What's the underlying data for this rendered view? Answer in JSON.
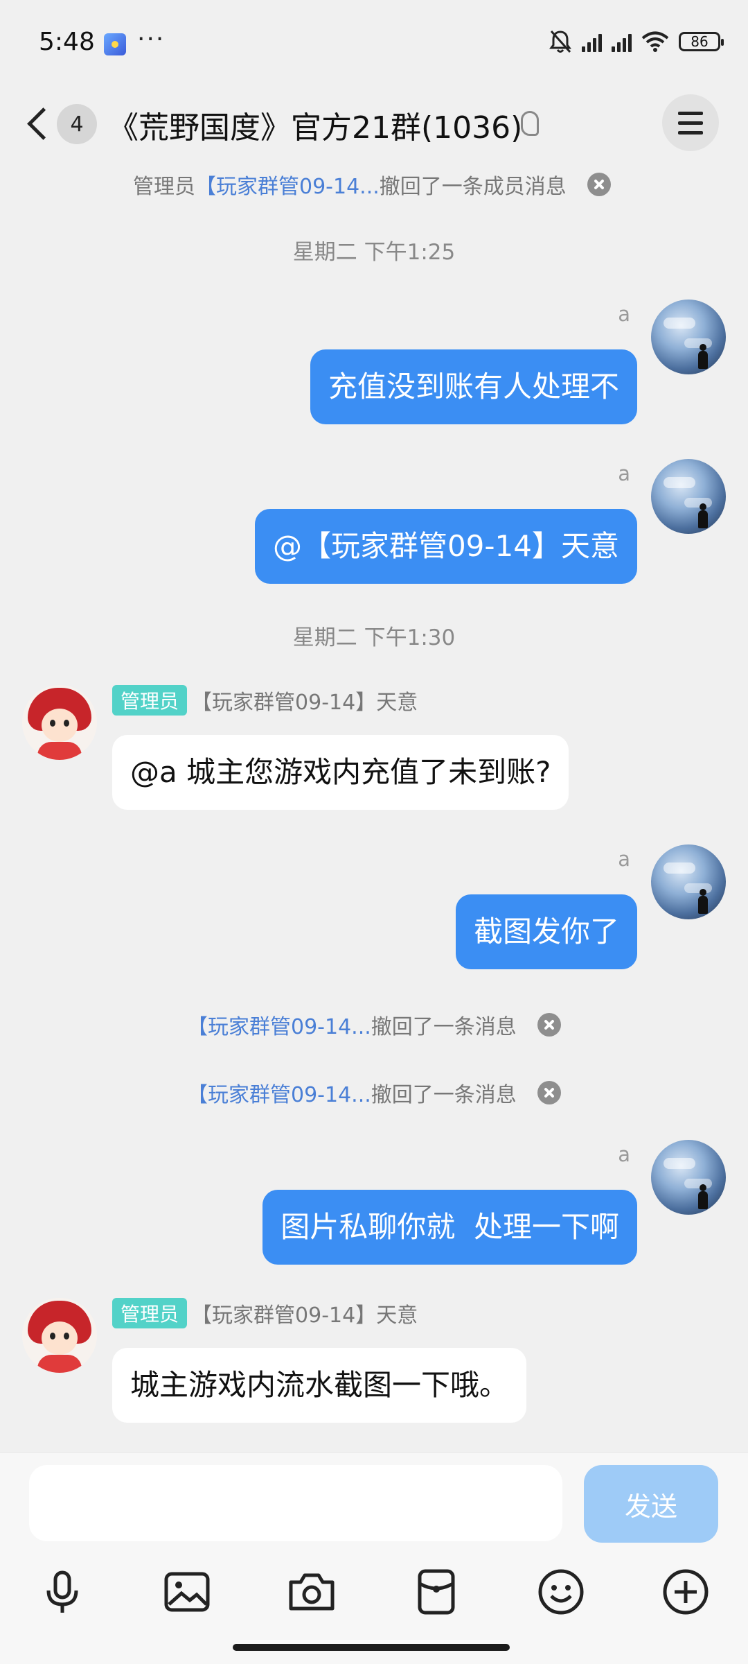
{
  "status_bar": {
    "time": "5:48",
    "dots": "···",
    "battery": "86"
  },
  "header": {
    "unread_count": "4",
    "title": "《荒野国度》官方21群(1036)"
  },
  "notices": [
    {
      "prefix": "管理员",
      "link": "【玩家群管09-14...",
      "suffix": "撤回了一条成员消息"
    },
    {
      "prefix": "",
      "link": "【玩家群管09-14...",
      "suffix": "撤回了一条消息"
    },
    {
      "prefix": "",
      "link": "【玩家群管09-14...",
      "suffix": "撤回了一条消息"
    }
  ],
  "timestamps": [
    "星期二 下午1:25",
    "星期二 下午1:30"
  ],
  "messages": [
    {
      "sender": "a",
      "text": "充值没到账有人处理不"
    },
    {
      "sender": "a",
      "text": "@【玩家群管09-14】天意"
    },
    {
      "admin_tag": "管理员",
      "sender": "【玩家群管09-14】天意",
      "text": "@a 城主您游戏内充值了未到账?"
    },
    {
      "sender": "a",
      "text": "截图发你了"
    },
    {
      "sender": "a",
      "text": "图片私聊你就  处理一下啊"
    },
    {
      "admin_tag": "管理员",
      "sender": "【玩家群管09-14】天意",
      "text": "城主游戏内流水截图一下哦。"
    }
  ],
  "input": {
    "placeholder": "",
    "send_label": "发送"
  },
  "colors": {
    "outgoing_bubble": "#3b8ef3",
    "admin_tag": "#52d2c8",
    "link": "#4a7fd6",
    "send_disabled": "#9ecbf7"
  }
}
